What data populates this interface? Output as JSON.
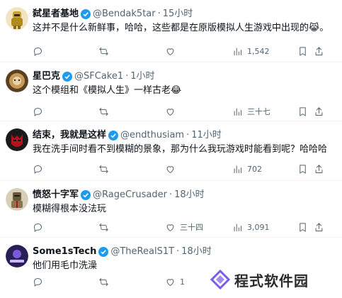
{
  "tweets": [
    {
      "name": "弑星者基地",
      "handle": "@Bendak5tar",
      "time": "15小时",
      "text": "这并不是什么新鲜事，哈哈，这些都是在原版模拟人生游戏中出现的😹。",
      "replies": "",
      "retweets": "",
      "likes": "",
      "views": "1,542",
      "avatar_color": "#c9a227"
    },
    {
      "name": "星巴克",
      "handle": "@SFCake1",
      "time": "1小时",
      "text": "这个模组和《模拟人生》一样古老😂",
      "replies": "",
      "retweets": "",
      "likes": "",
      "views": "三十七",
      "avatar_color": "#8a6a3a"
    },
    {
      "name": "结束，我就是这样",
      "handle": "@endthusiam",
      "time": "11小时",
      "text": "我在洗手间时看不到模糊的景象，那为什么我玩游戏时能看到呢？哈哈哈",
      "replies": "",
      "retweets": "",
      "likes": "",
      "views": "702",
      "avatar_color": "#b3131b"
    },
    {
      "name": "愤怒十字军",
      "handle": "@RageCrusader",
      "time": "18小时",
      "text": "模糊得根本没法玩",
      "replies": "",
      "retweets": "",
      "likes": "三十四",
      "views": "3,091",
      "avatar_color": "#6b5a3a"
    },
    {
      "name": "Some1sTech",
      "handle": "@TheRealS1T",
      "time": "18小时",
      "text": "他们用毛巾洗澡",
      "replies": "",
      "retweets": "",
      "likes": "1",
      "views": "",
      "avatar_color": "#3a2a6b"
    }
  ],
  "separator": "·",
  "watermark": "程式软件园",
  "colors": {
    "verified": "#1d9bf0",
    "muted": "#536471"
  }
}
